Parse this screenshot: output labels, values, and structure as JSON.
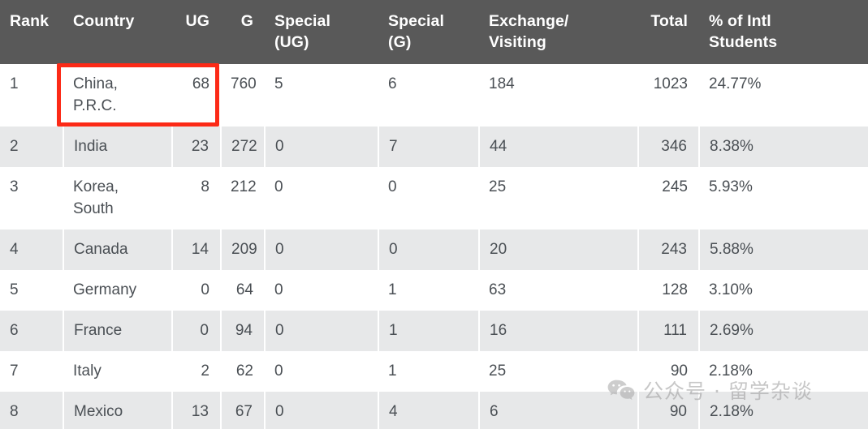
{
  "table": {
    "columns": [
      {
        "key": "rank",
        "label": "Rank",
        "align": "left"
      },
      {
        "key": "country",
        "label": "Country",
        "align": "left"
      },
      {
        "key": "ug",
        "label": "UG",
        "align": "right"
      },
      {
        "key": "g",
        "label": "G",
        "align": "right"
      },
      {
        "key": "s_ug",
        "label": "Special (UG)",
        "align": "left"
      },
      {
        "key": "s_g",
        "label": "Special (G)",
        "align": "left"
      },
      {
        "key": "exchange",
        "label": "Exchange/ Visiting",
        "align": "left"
      },
      {
        "key": "total",
        "label": "Total",
        "align": "right"
      },
      {
        "key": "pct",
        "label": "% of Intl Students",
        "align": "left"
      }
    ],
    "header_labels": {
      "rank": "Rank",
      "country": "Country",
      "ug": "UG",
      "g": "G",
      "s_ug_line1": "Special",
      "s_ug_line2": "(UG)",
      "s_g_line1": "Special",
      "s_g_line2": "(G)",
      "exchange_line1": "Exchange/",
      "exchange_line2": "Visiting",
      "total": "Total",
      "pct_line1": "% of Intl",
      "pct_line2": "Students"
    },
    "rows": [
      {
        "rank": "1",
        "country": "China, P.R.C.",
        "ug": "68",
        "g": "760",
        "s_ug": "5",
        "s_g": "6",
        "exchange": "184",
        "total": "1023",
        "pct": "24.77%"
      },
      {
        "rank": "2",
        "country": "India",
        "ug": "23",
        "g": "272",
        "s_ug": "0",
        "s_g": "7",
        "exchange": "44",
        "total": "346",
        "pct": "8.38%"
      },
      {
        "rank": "3",
        "country": "Korea, South",
        "ug": "8",
        "g": "212",
        "s_ug": "0",
        "s_g": "0",
        "exchange": "25",
        "total": "245",
        "pct": "5.93%"
      },
      {
        "rank": "4",
        "country": "Canada",
        "ug": "14",
        "g": "209",
        "s_ug": "0",
        "s_g": "0",
        "exchange": "20",
        "total": "243",
        "pct": "5.88%"
      },
      {
        "rank": "5",
        "country": "Germany",
        "ug": "0",
        "g": "64",
        "s_ug": "0",
        "s_g": "1",
        "exchange": "63",
        "total": "128",
        "pct": "3.10%"
      },
      {
        "rank": "6",
        "country": "France",
        "ug": "0",
        "g": "94",
        "s_ug": "0",
        "s_g": "1",
        "exchange": "16",
        "total": "111",
        "pct": "2.69%"
      },
      {
        "rank": "7",
        "country": "Italy",
        "ug": "2",
        "g": "62",
        "s_ug": "0",
        "s_g": "1",
        "exchange": "25",
        "total": "90",
        "pct": "2.18%"
      },
      {
        "rank": "8",
        "country": "Mexico",
        "ug": "13",
        "g": "67",
        "s_ug": "0",
        "s_g": "4",
        "exchange": "6",
        "total": "90",
        "pct": "2.18%"
      }
    ]
  },
  "annotation": {
    "name": "red-highlight-box",
    "color": "#fc2a17",
    "targets": "China, P.R.C. country and UG cells"
  },
  "watermark": {
    "icon": "wechat-icon",
    "text": "公众号 · 留学杂谈",
    "color": "#9b9b9b"
  },
  "colors": {
    "header_background": "#595959",
    "header_text": "#ffffff",
    "body_text": "#4a4f54",
    "row_stripe": "#e7e8e9",
    "row_base": "#ffffff",
    "annotation_red": "#fc2a17"
  }
}
